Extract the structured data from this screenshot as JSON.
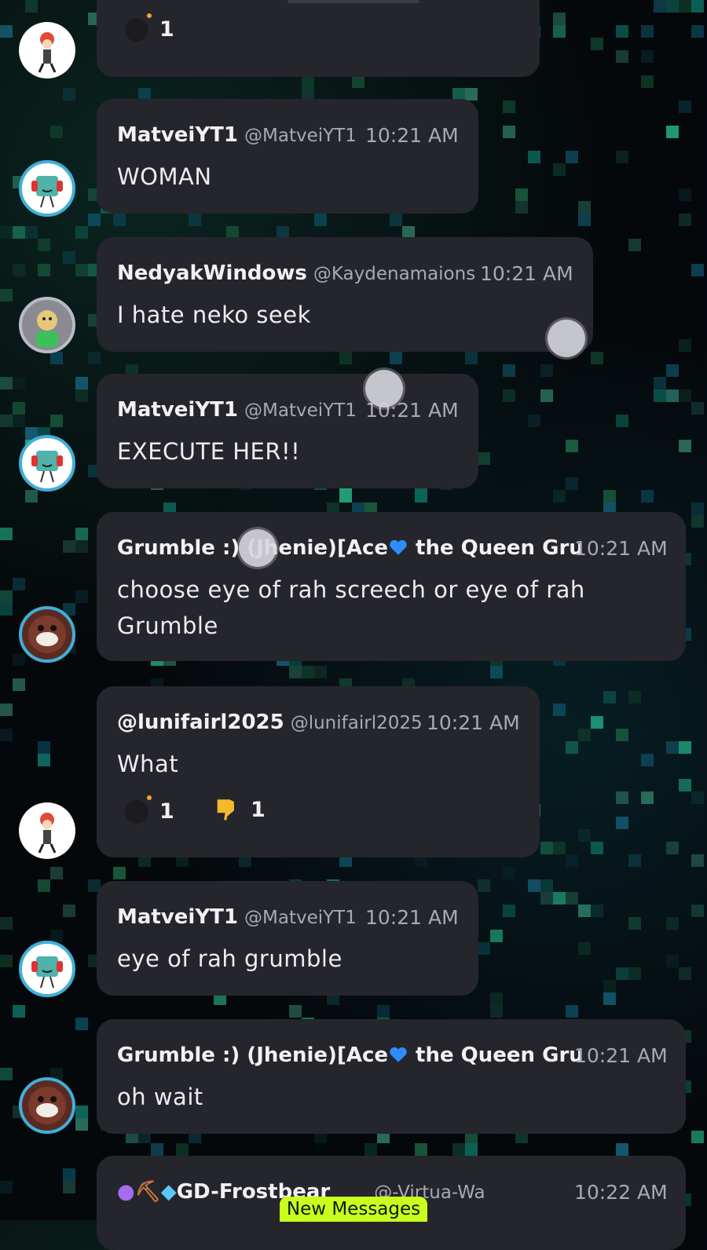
{
  "messages": [
    {
      "id": "m0",
      "reactions": [
        {
          "icon": "bomb-icon",
          "count": "1"
        }
      ]
    },
    {
      "id": "m1",
      "name": "MatveiYT1",
      "handle": "@MatveiYT1",
      "time": "10:21 AM",
      "text": "WOMAN"
    },
    {
      "id": "m2",
      "name": "NedyakWindows",
      "handle": "@Kaydenamaions",
      "time": "10:21 AM",
      "text": "I hate neko seek"
    },
    {
      "id": "m3",
      "name": "MatveiYT1",
      "handle": "@MatveiYT1",
      "time": "10:21 AM",
      "text": "EXECUTE HER!!"
    },
    {
      "id": "m4",
      "name_part1": "Grumble :) (Jhenie)[Ace",
      "name_part2": " the Queen Gru",
      "time": "10:21 AM",
      "text_line1": "choose eye of rah screech or eye of rah",
      "text_line2": "Grumble"
    },
    {
      "id": "m5",
      "name": "@lunifairl2025",
      "handle": "@lunifairl2025",
      "time": "10:21 AM",
      "text": "What",
      "reactions": [
        {
          "icon": "bomb-icon",
          "count": "1"
        },
        {
          "icon": "thumbs-down-icon",
          "count": "1"
        }
      ]
    },
    {
      "id": "m6",
      "name": "MatveiYT1",
      "handle": "@MatveiYT1",
      "time": "10:21 AM",
      "text": "eye of rah grumble"
    },
    {
      "id": "m7",
      "name_part1": "Grumble :) (Jhenie)[Ace",
      "name_part2": " the Queen Gru",
      "time": "10:21 AM",
      "text": "oh wait"
    },
    {
      "id": "m8",
      "name": "GD-Frostbear",
      "handle": "@-Virtua-Wa",
      "time": "10:22 AM"
    }
  ],
  "new_messages_label": "New Messages",
  "colors": {
    "bubble": "#25252c",
    "accent": "#c8ff1e",
    "heart": "#2f8cff",
    "background": "#05080b"
  }
}
